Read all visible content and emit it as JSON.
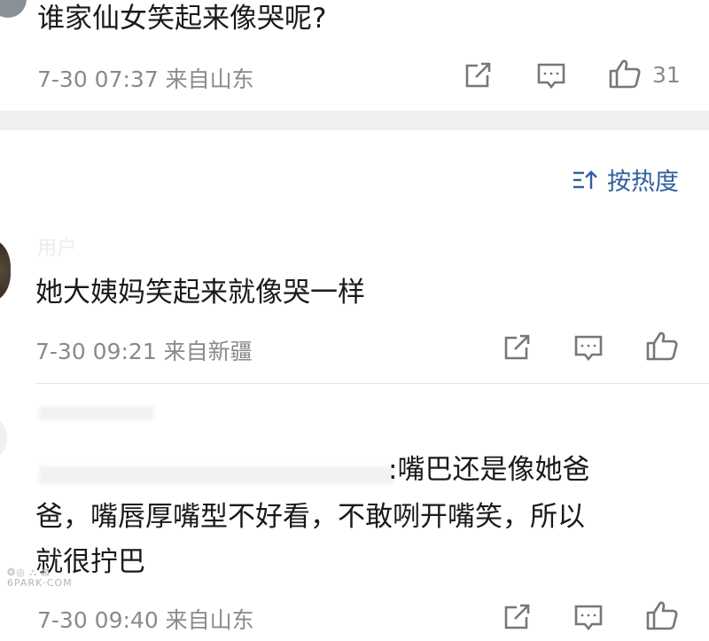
{
  "comments": [
    {
      "text": "谁家仙女笑起来像哭呢?",
      "meta": "7-30 07:37 来自山东",
      "likes": "31"
    },
    {
      "text": "她大姨妈笑起来就像哭一样",
      "meta": "7-30 09:21 来自新疆"
    },
    {
      "line1": ":嘴巴还是像她爸",
      "line2": "爸，嘴唇厚嘴型不好看，不敢咧开嘴笑，所以",
      "line3": "就很拧巴",
      "meta": "7-30 09:40 来自山东"
    }
  ],
  "sort": {
    "label": "按热度"
  },
  "icons": {
    "share": "share-icon",
    "comment": "comment-icon",
    "like": "like-icon",
    "sort": "sort-icon"
  },
  "colors": {
    "accent": "#2f5f9e",
    "meta": "#8a8a8a",
    "separator": "#efefef"
  }
}
